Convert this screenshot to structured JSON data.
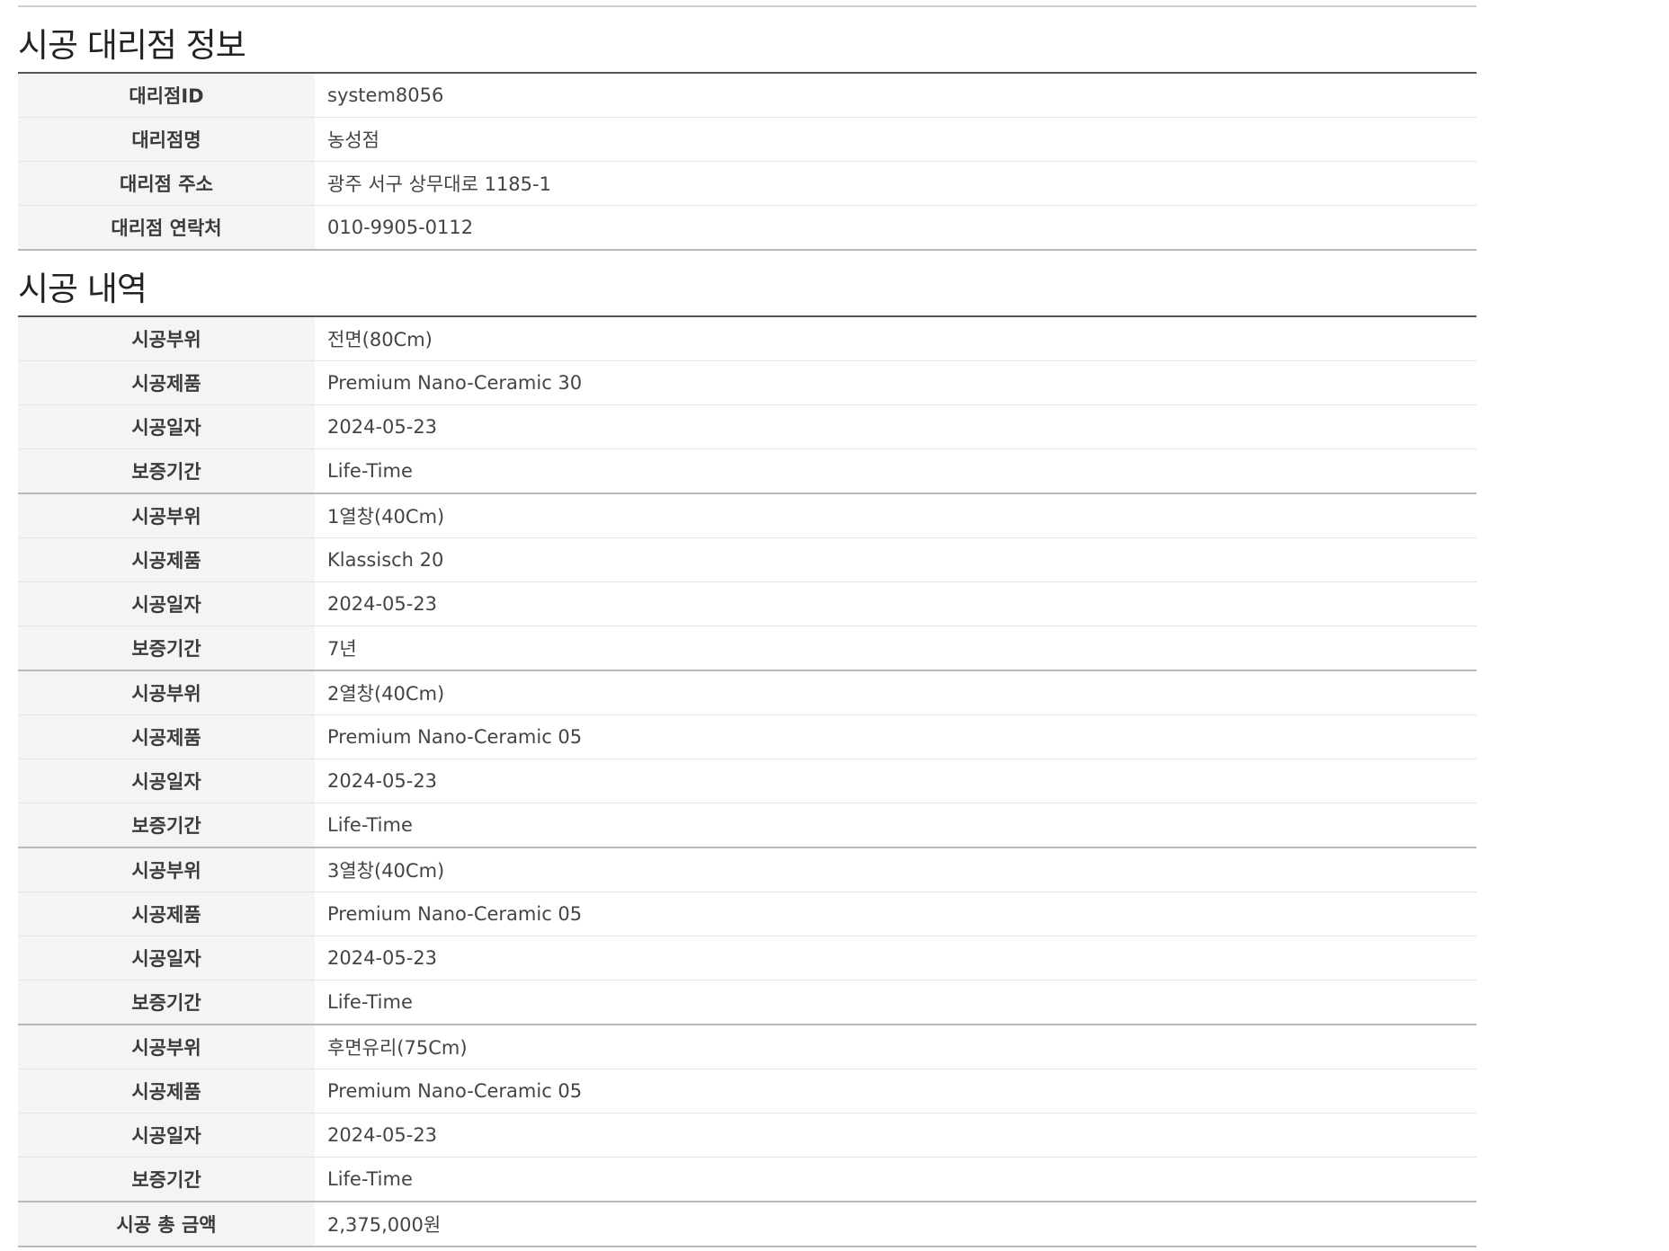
{
  "agency_section": {
    "title": "시공 대리점 정보",
    "rows": [
      {
        "label": "대리점ID",
        "value": "system8056"
      },
      {
        "label": "대리점명",
        "value": "농성점"
      },
      {
        "label": "대리점 주소",
        "value": "광주 서구 상무대로 1185-1"
      },
      {
        "label": "대리점 연락처",
        "value": "010-9905-0112"
      }
    ]
  },
  "history_section": {
    "title": "시공 내역",
    "entries": [
      {
        "part_label": "시공부위",
        "part": "전면(80Cm)",
        "product_label": "시공제품",
        "product": "Premium Nano-Ceramic 30",
        "date_label": "시공일자",
        "date": "2024-05-23",
        "warranty_label": "보증기간",
        "warranty": "Life-Time"
      },
      {
        "part_label": "시공부위",
        "part": "1열창(40Cm)",
        "product_label": "시공제품",
        "product": "Klassisch 20",
        "date_label": "시공일자",
        "date": "2024-05-23",
        "warranty_label": "보증기간",
        "warranty": "7년"
      },
      {
        "part_label": "시공부위",
        "part": "2열창(40Cm)",
        "product_label": "시공제품",
        "product": "Premium Nano-Ceramic 05",
        "date_label": "시공일자",
        "date": "2024-05-23",
        "warranty_label": "보증기간",
        "warranty": "Life-Time"
      },
      {
        "part_label": "시공부위",
        "part": "3열창(40Cm)",
        "product_label": "시공제품",
        "product": "Premium Nano-Ceramic 05",
        "date_label": "시공일자",
        "date": "2024-05-23",
        "warranty_label": "보증기간",
        "warranty": "Life-Time"
      },
      {
        "part_label": "시공부위",
        "part": "후면유리(75Cm)",
        "product_label": "시공제품",
        "product": "Premium Nano-Ceramic 05",
        "date_label": "시공일자",
        "date": "2024-05-23",
        "warranty_label": "보증기간",
        "warranty": "Life-Time"
      }
    ],
    "total": {
      "label": "시공 총 금액",
      "value": "2,375,000원"
    }
  }
}
